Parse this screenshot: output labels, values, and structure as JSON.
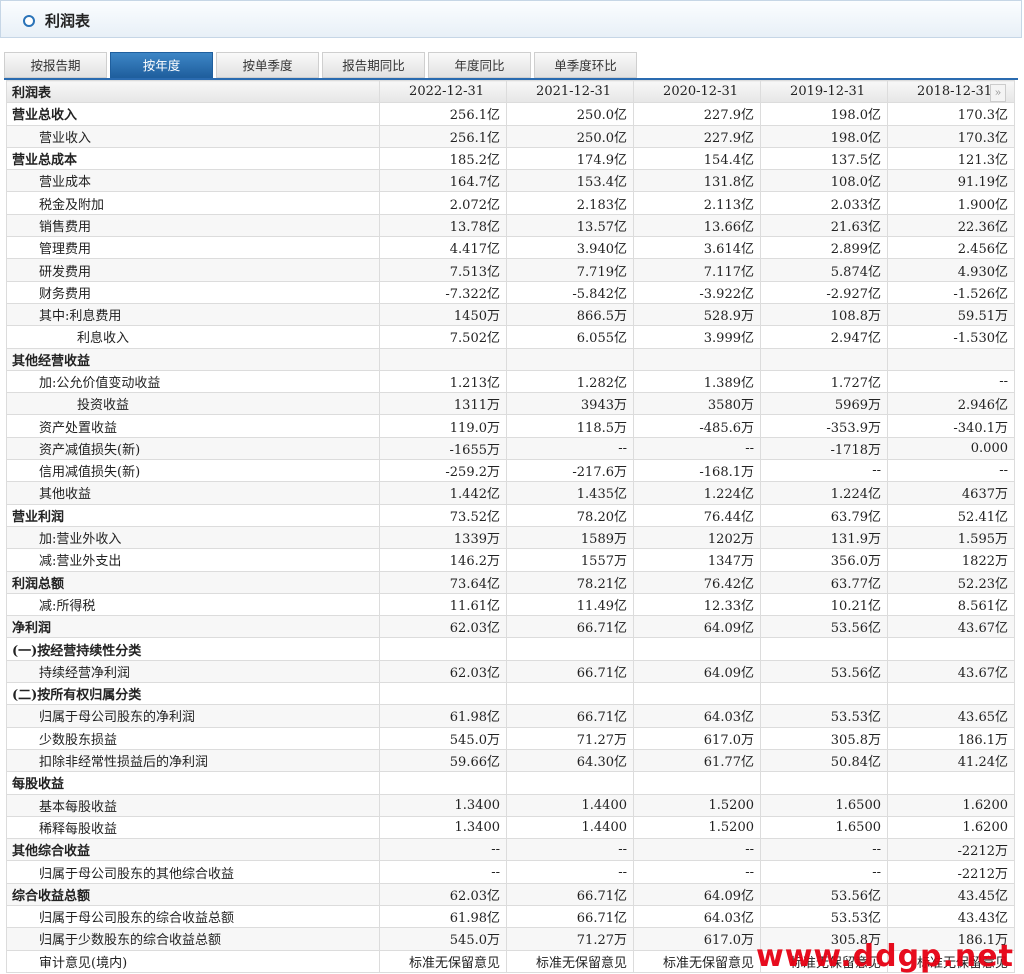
{
  "panel": {
    "title": "利润表"
  },
  "tabs": [
    "按报告期",
    "按年度",
    "按单季度",
    "报告期同比",
    "年度同比",
    "单季度环比"
  ],
  "active_tab": 1,
  "table": {
    "header_label": "利润表",
    "columns": [
      "2022-12-31",
      "2021-12-31",
      "2020-12-31",
      "2019-12-31",
      "2018-12-31"
    ],
    "rows": [
      {
        "label": "营业总收入",
        "level": 0,
        "values": [
          "256.1亿",
          "250.0亿",
          "227.9亿",
          "198.0亿",
          "170.3亿"
        ]
      },
      {
        "label": "营业收入",
        "level": 1,
        "values": [
          "256.1亿",
          "250.0亿",
          "227.9亿",
          "198.0亿",
          "170.3亿"
        ]
      },
      {
        "label": "营业总成本",
        "level": 0,
        "values": [
          "185.2亿",
          "174.9亿",
          "154.4亿",
          "137.5亿",
          "121.3亿"
        ]
      },
      {
        "label": "营业成本",
        "level": 1,
        "values": [
          "164.7亿",
          "153.4亿",
          "131.8亿",
          "108.0亿",
          "91.19亿"
        ]
      },
      {
        "label": "税金及附加",
        "level": 1,
        "values": [
          "2.072亿",
          "2.183亿",
          "2.113亿",
          "2.033亿",
          "1.900亿"
        ]
      },
      {
        "label": "销售费用",
        "level": 1,
        "values": [
          "13.78亿",
          "13.57亿",
          "13.66亿",
          "21.63亿",
          "22.36亿"
        ]
      },
      {
        "label": "管理费用",
        "level": 1,
        "values": [
          "4.417亿",
          "3.940亿",
          "3.614亿",
          "2.899亿",
          "2.456亿"
        ]
      },
      {
        "label": "研发费用",
        "level": 1,
        "values": [
          "7.513亿",
          "7.719亿",
          "7.117亿",
          "5.874亿",
          "4.930亿"
        ]
      },
      {
        "label": "财务费用",
        "level": 1,
        "values": [
          "-7.322亿",
          "-5.842亿",
          "-3.922亿",
          "-2.927亿",
          "-1.526亿"
        ]
      },
      {
        "label": "其中:利息费用",
        "level": 1,
        "values": [
          "1450万",
          "866.5万",
          "528.9万",
          "108.8万",
          "59.51万"
        ]
      },
      {
        "label": "利息收入",
        "level": 2,
        "values": [
          "7.502亿",
          "6.055亿",
          "3.999亿",
          "2.947亿",
          "-1.530亿"
        ]
      },
      {
        "label": "其他经营收益",
        "level": 0,
        "values": [
          "",
          "",
          "",
          "",
          ""
        ]
      },
      {
        "label": "加:公允价值变动收益",
        "level": 1,
        "values": [
          "1.213亿",
          "1.282亿",
          "1.389亿",
          "1.727亿",
          "--"
        ]
      },
      {
        "label": "投资收益",
        "level": 2,
        "values": [
          "1311万",
          "3943万",
          "3580万",
          "5969万",
          "2.946亿"
        ]
      },
      {
        "label": "资产处置收益",
        "level": 1,
        "values": [
          "119.0万",
          "118.5万",
          "-485.6万",
          "-353.9万",
          "-340.1万"
        ]
      },
      {
        "label": "资产减值损失(新)",
        "level": 1,
        "values": [
          "-1655万",
          "--",
          "--",
          "-1718万",
          "0.000"
        ]
      },
      {
        "label": "信用减值损失(新)",
        "level": 1,
        "values": [
          "-259.2万",
          "-217.6万",
          "-168.1万",
          "--",
          "--"
        ]
      },
      {
        "label": "其他收益",
        "level": 1,
        "values": [
          "1.442亿",
          "1.435亿",
          "1.224亿",
          "1.224亿",
          "4637万"
        ]
      },
      {
        "label": "营业利润",
        "level": 0,
        "values": [
          "73.52亿",
          "78.20亿",
          "76.44亿",
          "63.79亿",
          "52.41亿"
        ]
      },
      {
        "label": "加:营业外收入",
        "level": 1,
        "values": [
          "1339万",
          "1589万",
          "1202万",
          "131.9万",
          "1.595万"
        ]
      },
      {
        "label": "减:营业外支出",
        "level": 1,
        "values": [
          "146.2万",
          "1557万",
          "1347万",
          "356.0万",
          "1822万"
        ]
      },
      {
        "label": "利润总额",
        "level": 0,
        "values": [
          "73.64亿",
          "78.21亿",
          "76.42亿",
          "63.77亿",
          "52.23亿"
        ]
      },
      {
        "label": "减:所得税",
        "level": 1,
        "values": [
          "11.61亿",
          "11.49亿",
          "12.33亿",
          "10.21亿",
          "8.561亿"
        ]
      },
      {
        "label": "净利润",
        "level": 0,
        "values": [
          "62.03亿",
          "66.71亿",
          "64.09亿",
          "53.56亿",
          "43.67亿"
        ]
      },
      {
        "label": "(一)按经营持续性分类",
        "level": 0,
        "values": [
          "",
          "",
          "",
          "",
          ""
        ]
      },
      {
        "label": "持续经营净利润",
        "level": 1,
        "values": [
          "62.03亿",
          "66.71亿",
          "64.09亿",
          "53.56亿",
          "43.67亿"
        ]
      },
      {
        "label": "(二)按所有权归属分类",
        "level": 0,
        "values": [
          "",
          "",
          "",
          "",
          ""
        ]
      },
      {
        "label": "归属于母公司股东的净利润",
        "level": 1,
        "values": [
          "61.98亿",
          "66.71亿",
          "64.03亿",
          "53.53亿",
          "43.65亿"
        ]
      },
      {
        "label": "少数股东损益",
        "level": 1,
        "values": [
          "545.0万",
          "71.27万",
          "617.0万",
          "305.8万",
          "186.1万"
        ]
      },
      {
        "label": "扣除非经常性损益后的净利润",
        "level": 1,
        "values": [
          "59.66亿",
          "64.30亿",
          "61.77亿",
          "50.84亿",
          "41.24亿"
        ]
      },
      {
        "label": "每股收益",
        "level": 0,
        "values": [
          "",
          "",
          "",
          "",
          ""
        ]
      },
      {
        "label": "基本每股收益",
        "level": 1,
        "values": [
          "1.3400",
          "1.4400",
          "1.5200",
          "1.6500",
          "1.6200"
        ]
      },
      {
        "label": "稀释每股收益",
        "level": 1,
        "values": [
          "1.3400",
          "1.4400",
          "1.5200",
          "1.6500",
          "1.6200"
        ]
      },
      {
        "label": "其他综合收益",
        "level": 0,
        "values": [
          "--",
          "--",
          "--",
          "--",
          "-2212万"
        ]
      },
      {
        "label": "归属于母公司股东的其他综合收益",
        "level": 1,
        "values": [
          "--",
          "--",
          "--",
          "--",
          "-2212万"
        ]
      },
      {
        "label": "综合收益总额",
        "level": 0,
        "values": [
          "62.03亿",
          "66.71亿",
          "64.09亿",
          "53.56亿",
          "43.45亿"
        ]
      },
      {
        "label": "归属于母公司股东的综合收益总额",
        "level": 1,
        "values": [
          "61.98亿",
          "66.71亿",
          "64.03亿",
          "53.53亿",
          "43.43亿"
        ]
      },
      {
        "label": "归属于少数股东的综合收益总额",
        "level": 1,
        "values": [
          "545.0万",
          "71.27万",
          "617.0万",
          "305.8万",
          "186.1万"
        ]
      },
      {
        "label": "审计意见(境内)",
        "level": 1,
        "values": [
          "标准无保留意见",
          "标准无保留意见",
          "标准无保留意见",
          "标准无保留意见",
          "标准无保留意见"
        ]
      }
    ]
  },
  "scroll_right_glyph": "»",
  "watermark": "www.ddgp.net"
}
